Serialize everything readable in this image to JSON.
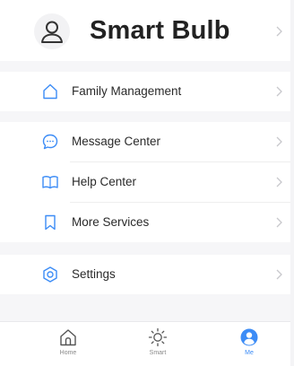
{
  "profile": {
    "name": "Smart Bulb",
    "avatar_icon": "user-outline-icon"
  },
  "menu": {
    "family_management": {
      "label": "Family Management",
      "icon": "home-outline-icon"
    },
    "message_center": {
      "label": "Message Center",
      "icon": "chat-bubble-icon"
    },
    "help_center": {
      "label": "Help Center",
      "icon": "book-open-icon"
    },
    "more_services": {
      "label": "More Services",
      "icon": "bookmark-icon"
    },
    "settings": {
      "label": "Settings",
      "icon": "hexagon-gear-icon"
    }
  },
  "tabs": {
    "home": {
      "label": "Home",
      "icon": "home-outline-icon"
    },
    "smart": {
      "label": "Smart",
      "icon": "sun-icon"
    },
    "me": {
      "label": "Me",
      "icon": "user-filled-icon",
      "active": true
    }
  },
  "colors": {
    "accent": "#3c8cf6",
    "text": "#2a2a2a",
    "chevron": "#c8c8cc",
    "section_gap": "#f6f6f8"
  }
}
